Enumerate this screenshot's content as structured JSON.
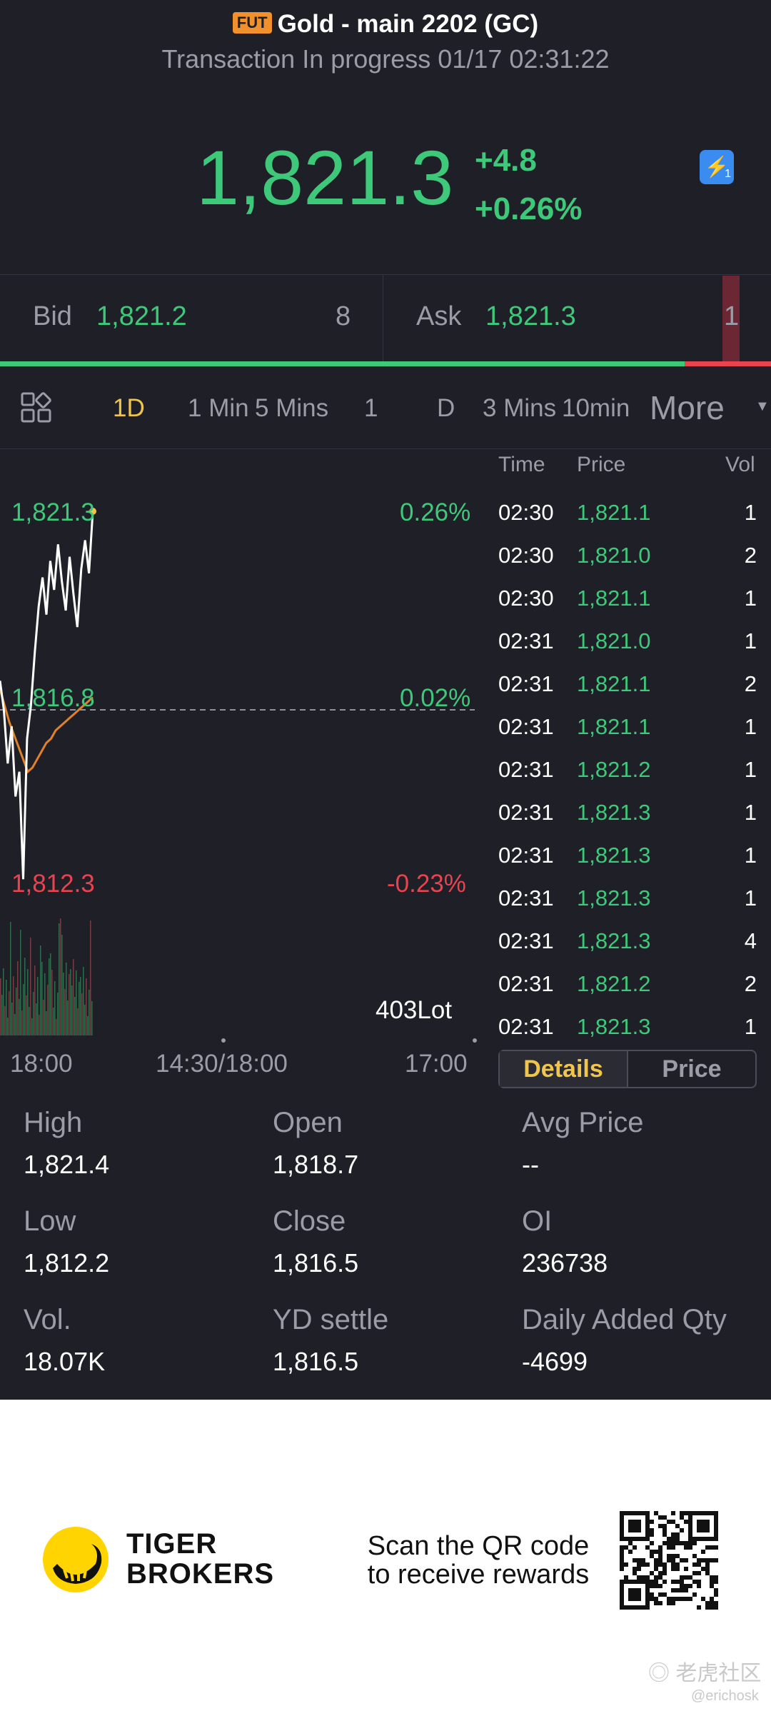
{
  "header": {
    "badge": "FUT",
    "title": "Gold - main 2202 (GC)",
    "status": "Transaction In progress 01/17 02:31:22",
    "price": "1,821.3",
    "change": "+4.8",
    "change_pct": "+0.26%",
    "flash_label": "1"
  },
  "quote": {
    "bid_label": "Bid",
    "bid_price": "1,821.2",
    "bid_qty": "8",
    "ask_label": "Ask",
    "ask_price": "1,821.3",
    "ask_qty": "1",
    "bid_ratio": 0.888
  },
  "tabs": {
    "items": [
      "1D",
      "1 Min",
      "5 Mins",
      "1",
      "D",
      "3 Mins",
      "10min"
    ],
    "active": "1D",
    "more": "More"
  },
  "chart": {
    "price_top": "1,821.3",
    "pct_top": "0.26%",
    "price_mid": "1,816.8",
    "pct_mid": "0.02%",
    "price_low": "1,812.3",
    "pct_low": "-0.23%",
    "volume_label": "403Lot",
    "time_left": "18:00",
    "time_mid": "14:30/18:00",
    "time_right": "17:00"
  },
  "chart_data": {
    "type": "line",
    "ylim": [
      1812.3,
      1821.3
    ],
    "series": [
      {
        "values": [
          1817.2,
          1816.5,
          1815.2,
          1816.1,
          1814.4,
          1815.0,
          1812.4,
          1815.8,
          1816.6,
          1817.9,
          1819.0,
          1819.7,
          1818.8,
          1820.1,
          1819.4,
          1820.5,
          1819.6,
          1818.9,
          1820.2,
          1819.3,
          1818.5,
          1819.9,
          1820.6,
          1819.8,
          1821.3
        ]
      },
      {
        "values": [
          1817.0,
          1816.6,
          1816.2,
          1815.9,
          1815.6,
          1815.3,
          1815.0,
          1815.1,
          1815.3,
          1815.5,
          1815.7,
          1815.8,
          1816.0,
          1816.1,
          1816.2,
          1816.3,
          1816.4,
          1816.5,
          1816.6,
          1816.7,
          1816.8
        ]
      }
    ]
  },
  "trades": {
    "headers": [
      "Time",
      "Price",
      "Vol"
    ],
    "rows": [
      [
        "02:30",
        "1,821.1",
        "1"
      ],
      [
        "02:30",
        "1,821.0",
        "2"
      ],
      [
        "02:30",
        "1,821.1",
        "1"
      ],
      [
        "02:31",
        "1,821.0",
        "1"
      ],
      [
        "02:31",
        "1,821.1",
        "2"
      ],
      [
        "02:31",
        "1,821.1",
        "1"
      ],
      [
        "02:31",
        "1,821.2",
        "1"
      ],
      [
        "02:31",
        "1,821.3",
        "1"
      ],
      [
        "02:31",
        "1,821.3",
        "1"
      ],
      [
        "02:31",
        "1,821.3",
        "1"
      ],
      [
        "02:31",
        "1,821.3",
        "4"
      ],
      [
        "02:31",
        "1,821.2",
        "2"
      ],
      [
        "02:31",
        "1,821.3",
        "1"
      ]
    ],
    "tab_details": "Details",
    "tab_price": "Price"
  },
  "stats": [
    {
      "label": "High",
      "value": "1,821.4"
    },
    {
      "label": "Open",
      "value": "1,818.7"
    },
    {
      "label": "Avg Price",
      "value": "--"
    },
    {
      "label": "Low",
      "value": "1,812.2"
    },
    {
      "label": "Close",
      "value": "1,816.5"
    },
    {
      "label": "OI",
      "value": "236738"
    },
    {
      "label": "Vol.",
      "value": "18.07K"
    },
    {
      "label": "YD settle",
      "value": "1,816.5"
    },
    {
      "label": "Daily Added Qty",
      "value": "-4699"
    }
  ],
  "footer": {
    "brand_line1": "TIGER",
    "brand_line2": "BROKERS",
    "scan_line1": "Scan the QR code",
    "scan_line2": "to receive rewards",
    "watermark_cn": "老虎社区",
    "watermark_user": "@erichosk"
  }
}
